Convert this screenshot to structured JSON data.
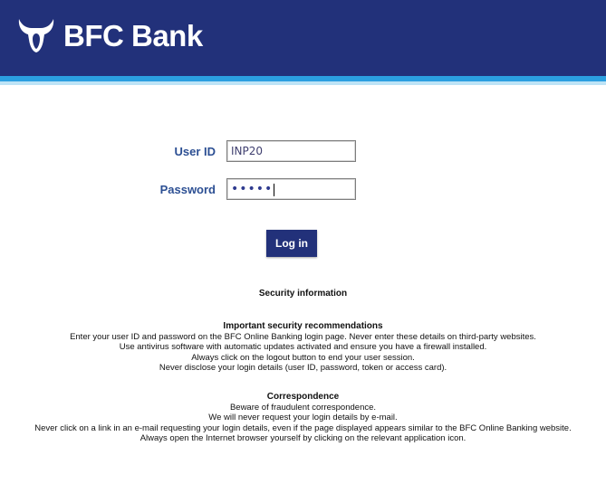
{
  "header": {
    "brand_name": "BFC Bank",
    "logo_icon": "bull-head-icon",
    "colors": {
      "header_bg": "#22317a",
      "stripe_primary": "#2b9fe0",
      "stripe_light": "#bde3f6"
    }
  },
  "login_form": {
    "user_id_label": "User ID",
    "user_id_value": "INP20",
    "password_label": "Password",
    "password_value": "•••••",
    "login_button_label": "Log in"
  },
  "security": {
    "title": "Security information",
    "recommendations": {
      "title": "Important security recommendations",
      "lines": [
        "Enter your user ID and password on the BFC Online Banking login page. Never enter these details on third-party websites.",
        "Use antivirus software with automatic updates activated and ensure you have a firewall installed.",
        "Always click on the logout button to end your user session.",
        "Never disclose your login details (user ID, password, token or access card)."
      ]
    },
    "correspondence": {
      "title": "Correspondence",
      "lines": [
        "Beware of fraudulent correspondence.",
        "We will never request your login details by e-mail.",
        "Never click on a link in an e-mail requesting your login details, even if the page displayed appears similar to the BFC Online Banking website.",
        "Always open the Internet browser yourself by clicking on the relevant application icon."
      ]
    }
  }
}
